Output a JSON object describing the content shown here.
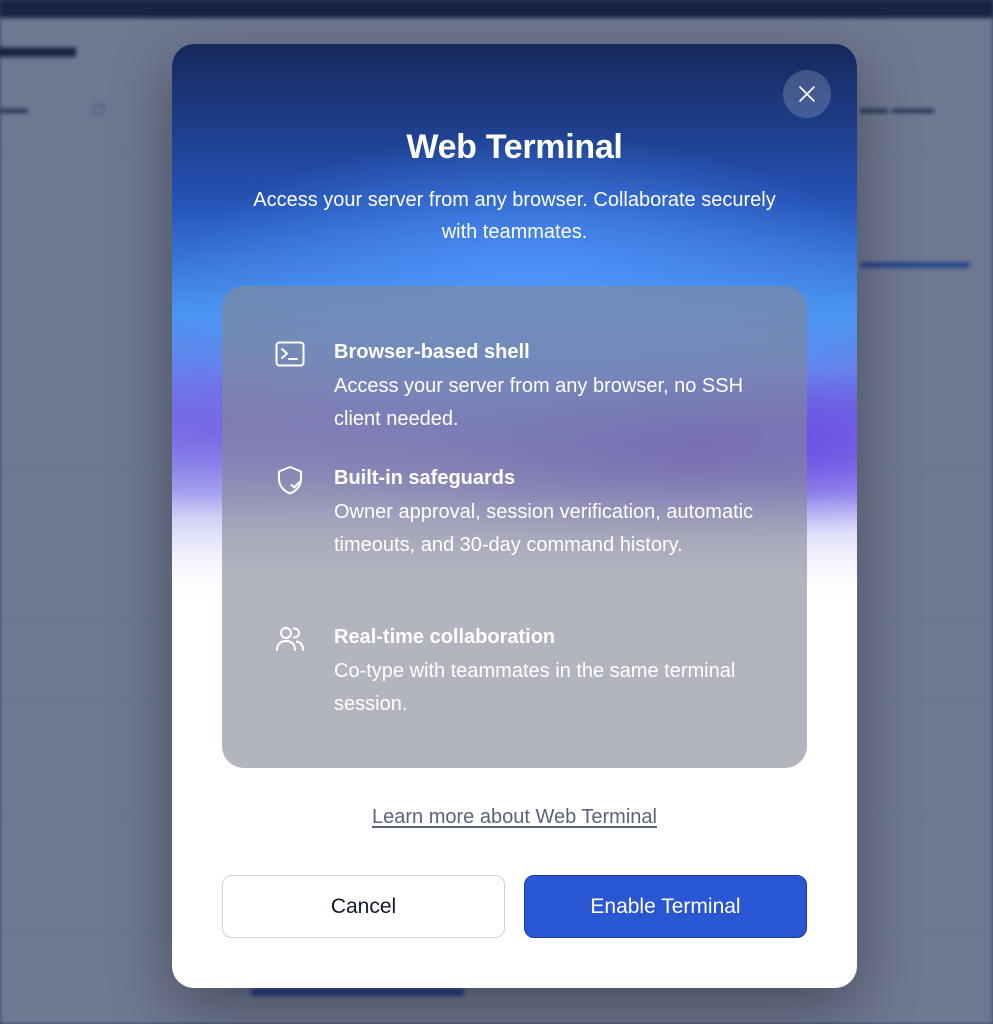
{
  "modal": {
    "title": "Web Terminal",
    "subtitle": "Access your server from any browser. Collaborate securely with teammates.",
    "close_icon": "close-icon",
    "features": [
      {
        "icon": "terminal-icon",
        "title": "Browser-based shell",
        "description": "Access your server from any browser, no SSH client needed."
      },
      {
        "icon": "shield-check-icon",
        "title": "Built-in safeguards",
        "description": "Owner approval, session verification, automatic timeouts, and 30-day command history."
      },
      {
        "icon": "users-icon",
        "title": "Real-time collaboration",
        "description": "Co-type with teammates in the same terminal session."
      }
    ],
    "learn_more_link": "Learn more about Web Terminal",
    "cancel_label": "Cancel",
    "enable_label": "Enable Terminal"
  },
  "colors": {
    "primary_button": "#2957d3",
    "overlay": "#16244a",
    "card": "#848896"
  }
}
